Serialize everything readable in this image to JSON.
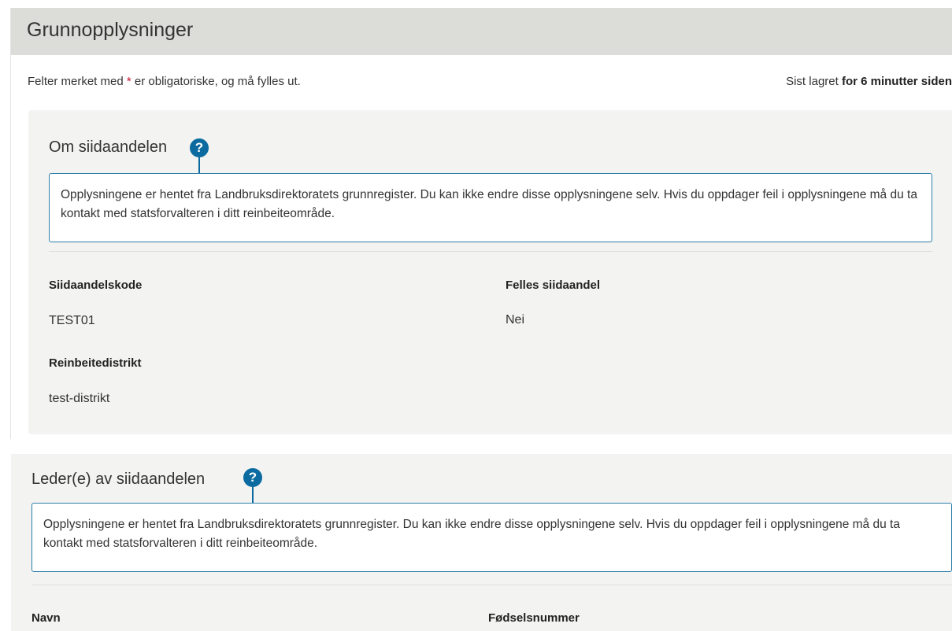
{
  "page": {
    "title": "Grunnopplysninger",
    "required_note_before": "Felter merket med ",
    "required_star": "*",
    "required_note_after": " er obligatoriske, og må fylles ut.",
    "saved_prefix": "Sist lagret ",
    "saved_time": "for 6 minutter siden"
  },
  "about": {
    "title": "Om siidaandelen",
    "help_glyph": "?",
    "info_text": "Opplysningene er hentet fra Landbruksdirektoratets grunnregister. Du kan ikke endre disse opplysningene selv. Hvis du oppdager feil i opplysningene må du ta kontakt med statsforvalteren i ditt reinbeiteområde.",
    "fields": {
      "code_label": "Siidaandelskode",
      "code_value": "TEST01",
      "shared_label": "Felles siidaandel",
      "shared_value": "Nei",
      "district_label": "Reinbeitedistrikt",
      "district_value": "test-distrikt"
    }
  },
  "leaders": {
    "title": "Leder(e) av siidaandelen",
    "help_glyph": "?",
    "info_text": "Opplysningene er hentet fra Landbruksdirektoratets grunnregister. Du kan ikke endre disse opplysningene selv. Hvis du oppdager feil i opplysningene må du ta kontakt med statsforvalteren i ditt reinbeiteområde.",
    "columns": {
      "name_label": "Navn",
      "ssn_label": "Fødselsnummer"
    }
  },
  "icons": {
    "help": "question-circle-icon"
  },
  "colors": {
    "accent": "#0b6aa0",
    "required": "#c8102e",
    "header_bg": "#dcdcd8",
    "panel_bg": "#f3f3f2"
  }
}
